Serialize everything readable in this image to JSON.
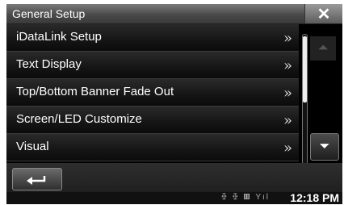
{
  "window": {
    "title": "General Setup",
    "close_label": "✕"
  },
  "menu": {
    "items": [
      {
        "label": "iDataLink Setup",
        "chevron": "»"
      },
      {
        "label": "Text Display",
        "chevron": "»"
      },
      {
        "label": "Top/Bottom Banner Fade Out",
        "chevron": "»"
      },
      {
        "label": "Screen/LED Customize",
        "chevron": "»"
      },
      {
        "label": "Visual",
        "chevron": "»"
      }
    ]
  },
  "scroll": {
    "up_label": "⏶",
    "down_label": "⏷",
    "position_fraction": 0
  },
  "status": {
    "clock": "12:18 PM",
    "icons": [
      "bluetooth-icon",
      "bluetooth-audio-icon",
      "battery-icon",
      "signal-icon"
    ],
    "icon_glyphs": "ꔀ ꔀ ▥ Yıl"
  }
}
